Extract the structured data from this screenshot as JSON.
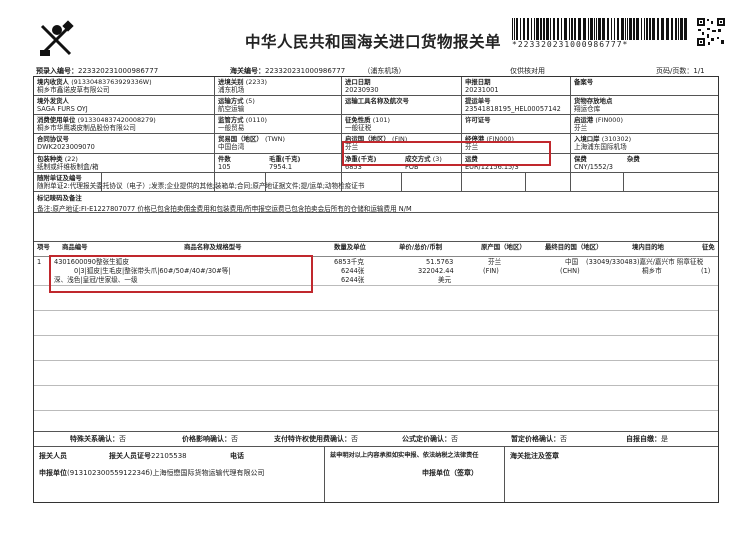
{
  "header": {
    "title": "中华人民共和国海关进口货物报关单",
    "barcode_number": "*223320231000986777*",
    "pre_entry_label": "预录入编号：",
    "pre_entry_no": "223320231000986777",
    "customs_no_label": "海关编号：",
    "customs_no": "223320231000986777",
    "port_note": "（浦东机场）",
    "usage_note": "仅供核对用",
    "page_label": "页码/页数：",
    "page_no": "1/1"
  },
  "row1": {
    "consignee_label": "境内收货人",
    "consignee_code": "(91330483763929336W)",
    "consignee_name": "桐乡市鑫诺皮草有限公司",
    "entry_port_label": "进境关别",
    "entry_port_code": "(2233)",
    "entry_port": "浦东机场",
    "import_date_label": "进口日期",
    "import_date": "20230930",
    "declare_date_label": "申报日期",
    "declare_date": "20231001",
    "record_no_label": "备案号",
    "record_no": ""
  },
  "row2": {
    "shipper_label": "境外发货人",
    "shipper": "SAGA FURS OYJ",
    "transport_label": "运输方式",
    "transport_code": "(5)",
    "transport": "航空运输",
    "vehicle_label": "运输工具名称及航次号",
    "vehicle": "",
    "bl_label": "提运单号",
    "bl_no": "23541818195_HEL00057142",
    "storage_label": "货物存放地点",
    "storage": "翔运仓库"
  },
  "row3": {
    "consumer_label": "消费使用单位",
    "consumer_code": "(913304837420008279)",
    "consumer_name": "桐乡市华鹰裘皮制品股份有限公司",
    "supervision_label": "监管方式",
    "supervision_code": "(0110)",
    "supervision": "一般贸易",
    "levy_label": "征免性质",
    "levy_code": "(101)",
    "levy": "一般征税",
    "license_label": "许可证号",
    "license": "",
    "origin_port_label": "启运港",
    "origin_port_code": "(FIN000)",
    "origin_port": "芬兰"
  },
  "row4": {
    "contract_label": "合同协议号",
    "contract": "DWK2023009070",
    "trade_country_label": "贸易国（地区）",
    "trade_country_code": "(TWN)",
    "trade_country": "中国台湾",
    "depart_country_label": "启运国（地区）",
    "depart_country_code": "(FIN)",
    "depart_country": "芬兰",
    "transit_port_label": "经停港",
    "transit_port_code": "(FIN000)",
    "transit_port": "芬兰",
    "entry_point_label": "入境口岸",
    "entry_point_code": "(310302)",
    "entry_point": "上海浦东国际机场"
  },
  "row5": {
    "package_label": "包装种类",
    "package_code": "(22)",
    "package": "纸制或纤维板制盒/箱",
    "pieces_label": "件数",
    "pieces": "105",
    "gross_label": "毛重(千克)",
    "gross": "7954.1",
    "net_label": "净重(千克)",
    "net": "6853",
    "deal_label": "成交方式",
    "deal_code": "(3)",
    "deal": "FOB",
    "freight_label": "运费",
    "freight": "EUR/12156.15/3",
    "insurance_label": "保费",
    "insurance": "CNY/1552/3",
    "misc_label": "杂费",
    "misc": ""
  },
  "docs": {
    "label": "随附单证及编号",
    "content": "随附单证2:代理报关委托协议（电子）;发票;企业提供的其他;装箱单;合同;原产地证据文件;提/运单;动物检疫证书"
  },
  "marks": {
    "label": "标记唛码及备注",
    "content": "备注:原产地证:FI-E1227807077 价格已包含拍卖佣金费用和包装费用/所申报空运费已包含拍卖会后所有的仓储和运输费用 N/M"
  },
  "goods_header": {
    "no": "项号",
    "code": "商品编号",
    "name": "商品名称及规格型号",
    "qty": "数量及单位",
    "price": "单价/总价/币制",
    "origin": "原产国（地区）",
    "dest": "最终目的国（地区）",
    "district": "境内目的地",
    "levy": "征免"
  },
  "goods": [
    {
      "no": "1",
      "code": "4301600090",
      "name_line1": "整张生狐皮",
      "name_line2": "0|3|狐皮|生毛皮|整张带头爪|60#/50#/40#/30#等|",
      "name_line3": "深、浅色|皇冠/世家级、一级",
      "qty1": "6853千克",
      "qty2": "6244张",
      "qty3": "6244张",
      "unit_price": "51.5763",
      "total_price": "322042.44",
      "currency": "美元",
      "origin": "芬兰",
      "origin_code": "(FIN)",
      "dest": "中国",
      "dest_code": "(CHN)",
      "district": "(33049/330483)嘉兴/嘉兴市 照章征税",
      "district2": "桐乡市",
      "levy_code": "(1)"
    }
  ],
  "footer_confirm": {
    "special_label": "特殊关系确认：",
    "special": "否",
    "price_label": "价格影响确认：",
    "price": "否",
    "royalty_label": "支付特许权使用费确认：",
    "royalty": "否",
    "formula_label": "公式定价确认：",
    "formula": "否",
    "provisional_label": "暂定价格确认：",
    "provisional": "否",
    "self_pay_label": "自报自缴：",
    "self_pay": "是"
  },
  "declarer": {
    "staff_label": "报关人员",
    "cert_label": "报关人员证号",
    "cert_no": "22105538",
    "phone_label": "电话",
    "statement": "兹申明对以上内容承担如实申报、依法纳税之法律责任",
    "approval_label": "海关批注及签章",
    "unit_label": "申报单位",
    "unit_code": "(91310230055912234б)",
    "unit_name": "上海恒懋国际货物运输代理有限公司",
    "stamp_label": "申报单位（签章）"
  }
}
